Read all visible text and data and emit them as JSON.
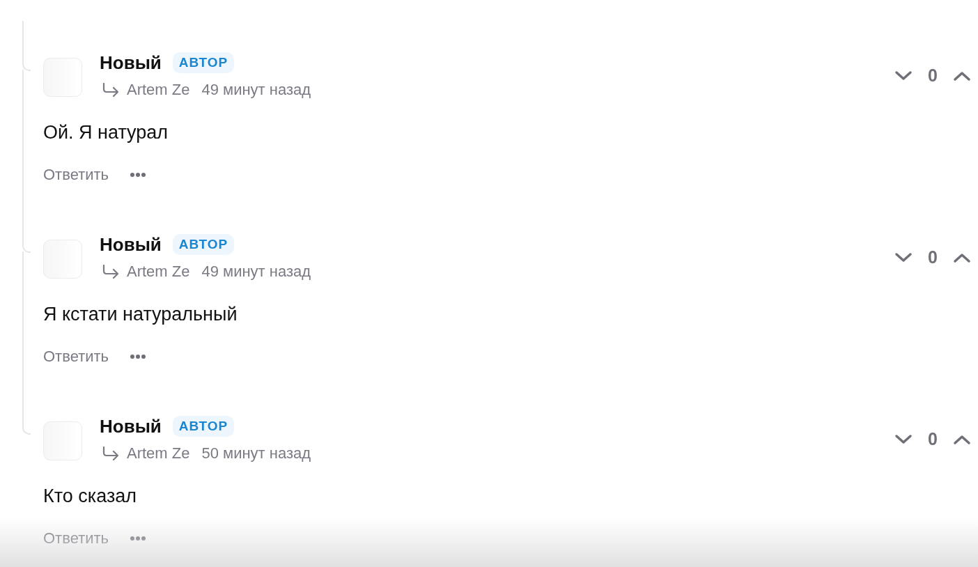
{
  "comments": [
    {
      "name": "Новый",
      "badge": "АВТОР",
      "reply_to": "Artem Ze",
      "time": "49 минут назад",
      "text": "Ой. Я натурал",
      "reply": "Ответить",
      "score": "0"
    },
    {
      "name": "Новый",
      "badge": "АВТОР",
      "reply_to": "Artem Ze",
      "time": "49 минут назад",
      "text": "Я кстати натуральный",
      "reply": "Ответить",
      "score": "0"
    },
    {
      "name": "Новый",
      "badge": "АВТОР",
      "reply_to": "Artem Ze",
      "time": "50 минут назад",
      "text": "Кто сказал",
      "reply": "Ответить",
      "score": "0"
    }
  ]
}
